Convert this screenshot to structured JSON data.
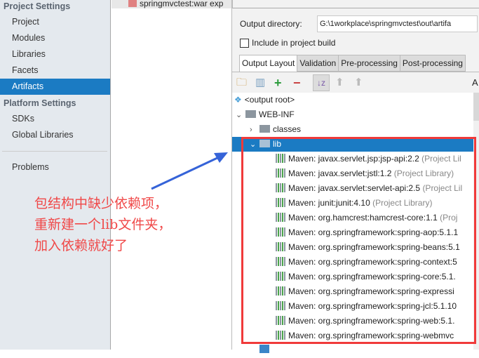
{
  "sidebar": {
    "project_settings": "Project Settings",
    "items": [
      "Project",
      "Modules",
      "Libraries",
      "Facets",
      "Artifacts"
    ],
    "platform_settings": "Platform Settings",
    "platform_items": [
      "SDKs",
      "Global Libraries"
    ],
    "problems": "Problems",
    "selected": "Artifacts"
  },
  "artifact_list": {
    "item": "springmvctest:war exp"
  },
  "config": {
    "output_dir_label": "Output directory:",
    "output_dir_value": "G:\\1workplace\\springmvctest\\out\\artifa",
    "include_label": "Include in project build",
    "include_checked": false
  },
  "tabs": [
    "Output Layout",
    "Validation",
    "Pre-processing",
    "Post-processing"
  ],
  "toolbar": {
    "available_prefix": "A"
  },
  "tree": {
    "root": "<output root>",
    "web_inf": "WEB-INF",
    "classes": "classes",
    "lib": "lib",
    "libs": [
      {
        "name": "Maven: javax.servlet.jsp:jsp-api:2.2",
        "suffix": "(Project Lil"
      },
      {
        "name": "Maven: javax.servlet:jstl:1.2",
        "suffix": "(Project Library)"
      },
      {
        "name": "Maven: javax.servlet:servlet-api:2.5",
        "suffix": "(Project Lil"
      },
      {
        "name": "Maven: junit:junit:4.10",
        "suffix": "(Project Library)"
      },
      {
        "name": "Maven: org.hamcrest:hamcrest-core:1.1",
        "suffix": "(Proj"
      },
      {
        "name": "Maven: org.springframework:spring-aop:5.1.1",
        "suffix": ""
      },
      {
        "name": "Maven: org.springframework:spring-beans:5.1",
        "suffix": ""
      },
      {
        "name": "Maven: org.springframework:spring-context:5",
        "suffix": ""
      },
      {
        "name": "Maven: org.springframework:spring-core:5.1.",
        "suffix": ""
      },
      {
        "name": "Maven: org.springframework:spring-expressi",
        "suffix": ""
      },
      {
        "name": "Maven: org.springframework:spring-jcl:5.1.10",
        "suffix": ""
      },
      {
        "name": "Maven: org.springframework:spring-web:5.1.",
        "suffix": ""
      },
      {
        "name": "Maven: org.springframework:spring-webmvc",
        "suffix": ""
      }
    ]
  },
  "annotation": {
    "lines": [
      "包结构中缺少依赖项，",
      "重新建一个lib文件夹，",
      "加入依赖就好了"
    ],
    "box_color": "#f03a3a",
    "arrow_color": "#3563d8"
  }
}
